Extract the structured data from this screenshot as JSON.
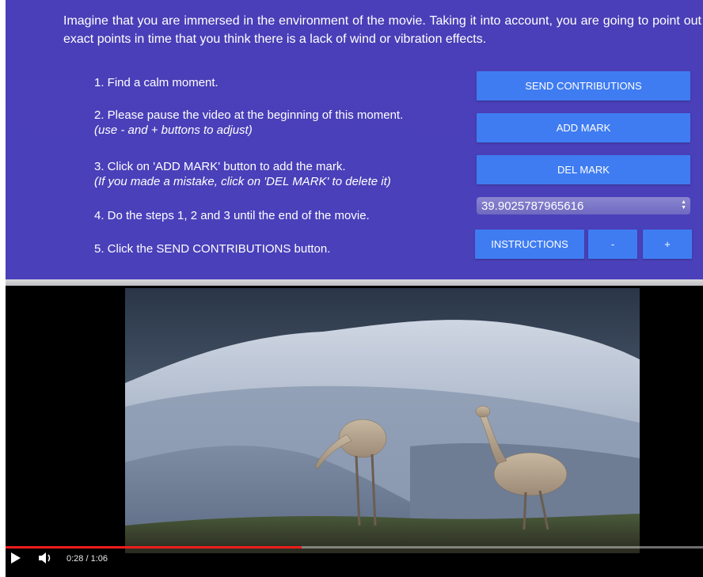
{
  "intro": "Imagine that you are immersed in the environment of the movie. Taking it into account, you are going to point out exact points in time that you think there is a lack of wind or vibration effects.",
  "steps": [
    {
      "text": "1. Find a calm moment.",
      "note": ""
    },
    {
      "text": "2. Please pause the video at the beginning of this moment.",
      "note": "(use - and + buttons to adjust)"
    },
    {
      "text": "3. Click on 'ADD MARK' button to add the mark.",
      "note": "(If you made a mistake, click on 'DEL MARK' to delete it)"
    },
    {
      "text": "4. Do the steps 1, 2 and 3 until the end of the movie.",
      "note": ""
    },
    {
      "text": "5. Click the SEND CONTRIBUTIONS button.",
      "note": ""
    }
  ],
  "buttons": {
    "send": "SEND CONTRIBUTIONS",
    "add": "ADD MARK",
    "del": "DEL MARK",
    "instructions": "INSTRUCTIONS",
    "minus": "-",
    "plus": "+"
  },
  "time_field": {
    "value": "39.9025787965616"
  },
  "video": {
    "current_time": "0:28",
    "duration": "1:06",
    "time_display": "0:28 / 1:06",
    "progress": 0.424
  },
  "icons": {
    "play": "play-icon",
    "volume": "volume-icon",
    "spinner": "spinner-arrows-icon"
  },
  "colors": {
    "panel_bg": "#4a3fb8",
    "button_bg": "#3f7cf2",
    "progress": "#ee1c1c"
  }
}
